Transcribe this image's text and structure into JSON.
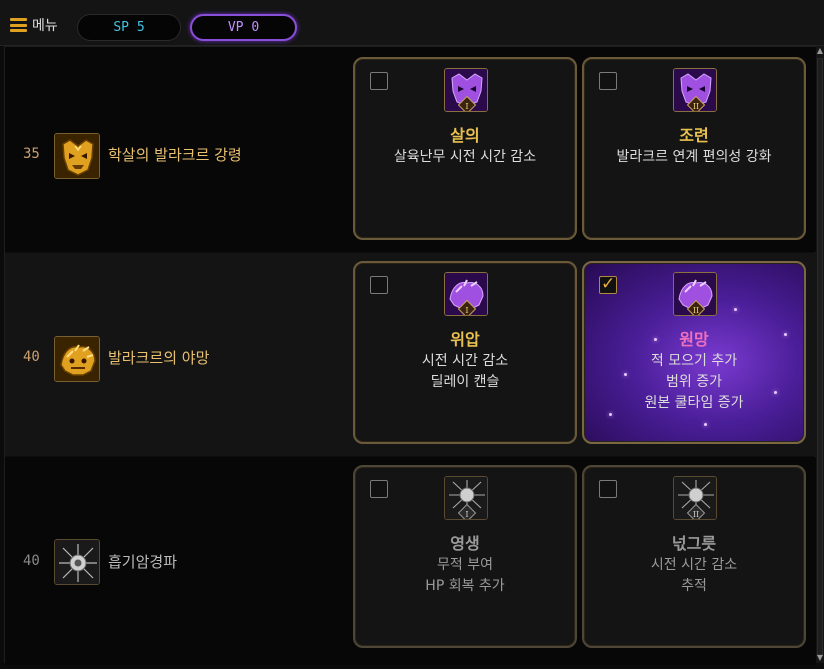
{
  "topbar": {
    "menu_label": "메뉴",
    "sp_label": "SP 5",
    "vp_label": "VP 0"
  },
  "rows": [
    {
      "level": "35",
      "skill_name": "학살의 발라크르 강령",
      "icon": "demon-mask-icon",
      "cards": [
        {
          "title": "살의",
          "desc": [
            "살육난무 시전 시간 감소"
          ],
          "checked": false,
          "icon": "demon-mask-tier1-icon"
        },
        {
          "title": "조련",
          "desc": [
            "발라크르 연계 편의성 강화"
          ],
          "checked": false,
          "icon": "demon-mask-tier2-icon"
        }
      ]
    },
    {
      "level": "40",
      "skill_name": "발라크르의 야망",
      "icon": "demon-beast-icon",
      "cards": [
        {
          "title": "위압",
          "desc": [
            "시전 시간 감소",
            "딜레이 캔슬"
          ],
          "checked": false,
          "icon": "demon-beast-tier1-icon"
        },
        {
          "title": "원망",
          "desc": [
            "적 모으기 추가",
            "범위 증가",
            "원본 쿨타임 증가"
          ],
          "checked": true,
          "icon": "demon-beast-tier2-icon"
        }
      ]
    },
    {
      "level": "40",
      "skill_name": "흡기암경파",
      "icon": "dark-burst-icon",
      "cards": [
        {
          "title": "영생",
          "desc": [
            "무적 부여",
            "HP 회복 추가"
          ],
          "checked": false,
          "icon": "dark-burst-tier1-icon"
        },
        {
          "title": "넋그릇",
          "desc": [
            "시전 시간 감소",
            "추적"
          ],
          "checked": false,
          "icon": "dark-burst-tier2-icon"
        }
      ]
    }
  ],
  "colors": {
    "gold": "#e8c050",
    "purple_accent": "#8a4fd8",
    "selected_title": "#f070c0"
  }
}
